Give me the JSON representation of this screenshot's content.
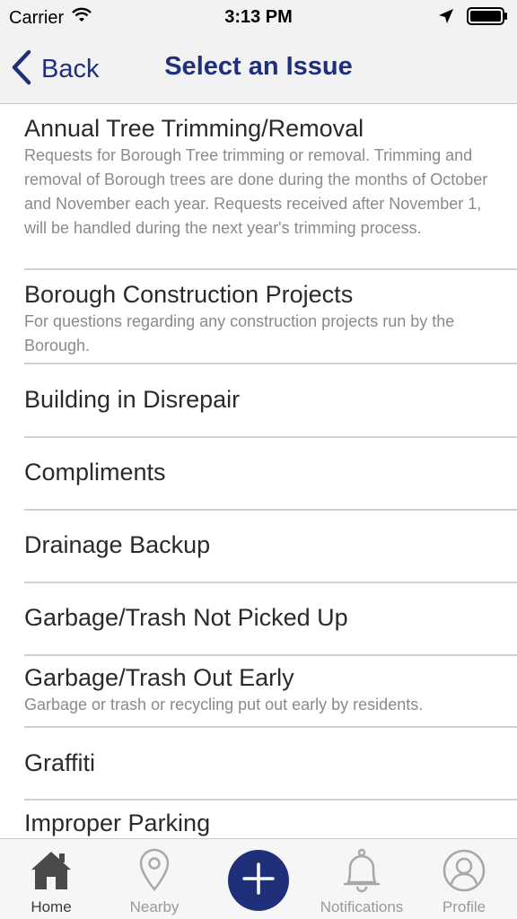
{
  "status_bar": {
    "carrier": "Carrier",
    "time": "3:13 PM"
  },
  "nav": {
    "back_label": "Back",
    "title": "Select an Issue"
  },
  "issues": [
    {
      "title": "Annual Tree Trimming/Removal",
      "description": "Requests for Borough Tree trimming or removal.  Trimming and removal of Borough trees are done during the months of October and November each year.  Requests received after November 1, will be handled during the next year's trimming process."
    },
    {
      "title": "Borough Construction Projects",
      "description": "For questions regarding any construction projects run by the Borough."
    },
    {
      "title": "Building in Disrepair",
      "description": ""
    },
    {
      "title": "Compliments",
      "description": ""
    },
    {
      "title": "Drainage Backup",
      "description": ""
    },
    {
      "title": "Garbage/Trash Not Picked Up",
      "description": ""
    },
    {
      "title": "Garbage/Trash Out Early",
      "description": "Garbage or trash or recycling put out early by residents."
    },
    {
      "title": "Graffiti",
      "description": ""
    },
    {
      "title": "Improper Parking",
      "description": ""
    }
  ],
  "tabs": {
    "home": "Home",
    "nearby": "Nearby",
    "notifications": "Notifications",
    "profile": "Profile"
  },
  "colors": {
    "accent": "#1f2f7a",
    "nav_background": "#f2f2f2",
    "divider": "#cfcfcf"
  },
  "icons": {
    "home": "house-icon",
    "nearby": "map-pin-icon",
    "add": "plus-icon",
    "notifications": "bell-icon",
    "profile": "user-circle-icon"
  }
}
